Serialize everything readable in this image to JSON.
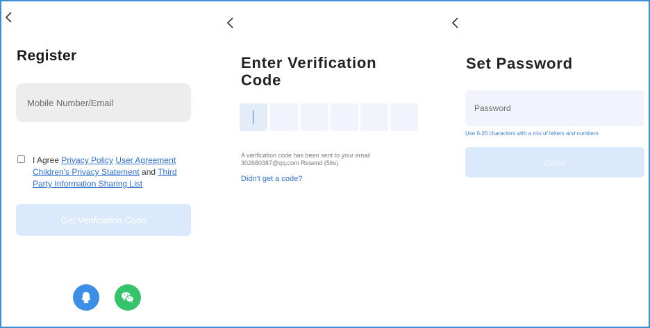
{
  "colors": {
    "frame_border": "#3a8ed8",
    "link": "#2f6fd1",
    "disabled_button": "#dbe9fc",
    "input_gray": "#ededed",
    "input_blue": "#f1f5fb",
    "qq": "#3d8ee6",
    "wechat": "#35c46a"
  },
  "register": {
    "back_icon": "chevron-left-icon",
    "title": "Register",
    "input_placeholder": "Mobile Number/Email",
    "agree_prefix": "I Agree",
    "links": {
      "privacy_policy": "Privacy Policy",
      "user_agreement": "User Agreement",
      "childrens_privacy": "Children's Privacy Statement",
      "and": "and",
      "third_party": "Third Party Information Sharing List"
    },
    "button_label": "Get Verification Code",
    "social": [
      "qq-icon",
      "wechat-icon"
    ]
  },
  "verification": {
    "back_icon": "chevron-left-icon",
    "title": "Enter Verification Code",
    "code_digits": [
      "",
      "",
      "",
      "",
      "",
      ""
    ],
    "info_line1": "A verification code has been sent to your email",
    "info_line2": "302680387@qq.com Resend (56s)",
    "help_link": "Didn't get a code?"
  },
  "password": {
    "back_icon": "chevron-left-icon",
    "title": "Set Password",
    "input_placeholder": "Password",
    "hint": "Use 6-20 characters with a mix of letters and numbers",
    "button_label": "Done"
  }
}
